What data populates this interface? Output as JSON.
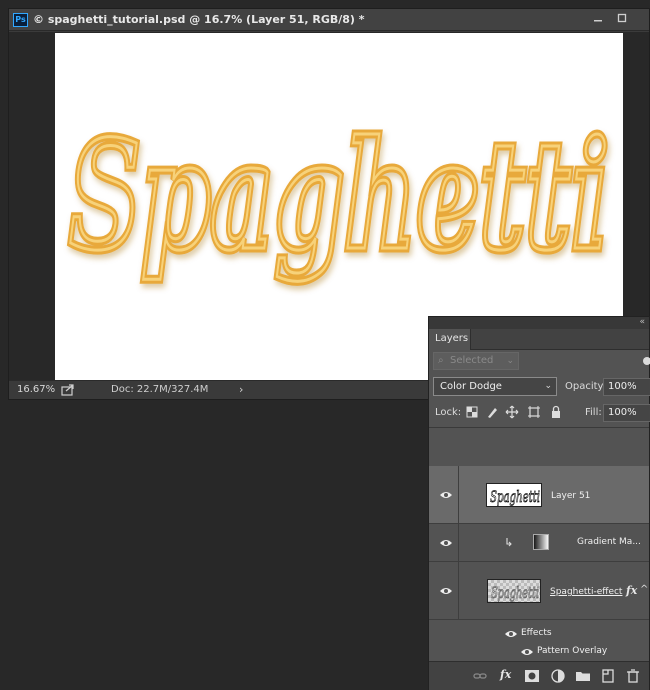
{
  "document": {
    "app_badge": "Ps",
    "title": "© spaghetti_tutorial.psd @ 16.7% (Layer 51, RGB/8) *",
    "canvas_text": "Spaghetti",
    "status": {
      "zoom": "16.67%",
      "doc_info": "Doc: 22.7M/327.4M"
    }
  },
  "layers_panel": {
    "tab": "Layers",
    "filter_placeholder": "Selected",
    "blend_mode": "Color Dodge",
    "opacity_label": "Opacity:",
    "opacity_value": "100%",
    "lock_label": "Lock:",
    "fill_label": "Fill:",
    "fill_value": "100%",
    "layers": [
      {
        "name": "Layer 51",
        "selected": true
      },
      {
        "name": "Gradient Ma...",
        "selected": false
      },
      {
        "name": "Spaghetti-effect",
        "selected": false
      }
    ],
    "effects_label": "Effects",
    "pattern_overlay_label": "Pattern Overlay",
    "fx_label": "fx"
  },
  "colors": {
    "spaghetti": "#e8a93a",
    "spaghetti_highlight": "#f7d27a",
    "ps_blue": "#31a8ff"
  }
}
